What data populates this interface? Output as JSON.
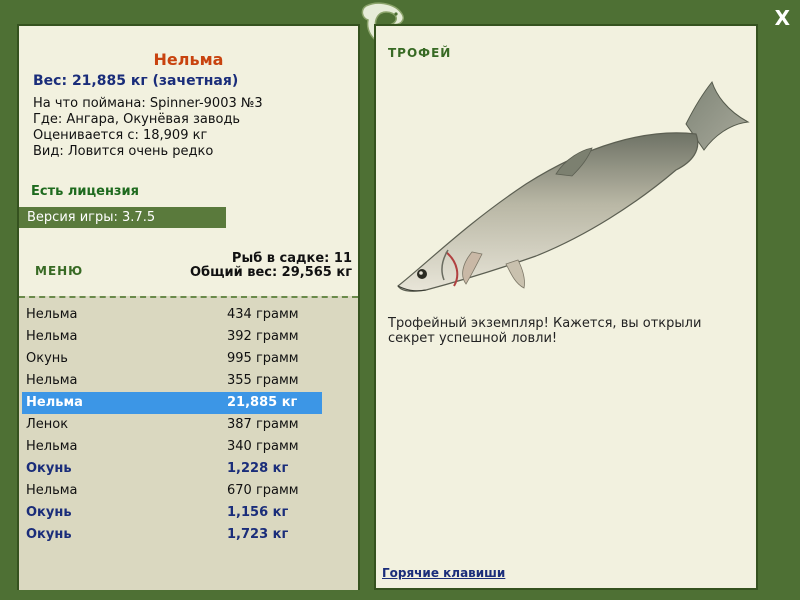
{
  "window": {
    "close_label": "X"
  },
  "left": {
    "fish_name": "Нельма",
    "weight": "Вес: 21,885 кг (зачетная)",
    "caught_with": "На что поймана: Spinner-9003 №3",
    "location": "Где: Ангара, Окунёвая заводь",
    "valued": "Оценивается с: 18,909 кг",
    "rarity": "Вид: Ловится очень редко",
    "license": "Есть лицензия",
    "version": "Версия игры: 3.7.5",
    "menu_label": "МЕНЮ",
    "fish_in_keepnet": "Рыб в садке: 11",
    "total_weight": "Общий вес: 29,565 кг"
  },
  "catch_list": [
    {
      "name": "Нельма",
      "weight": "434 грамм",
      "style": "normal"
    },
    {
      "name": "Нельма",
      "weight": "392 грамм",
      "style": "normal"
    },
    {
      "name": "Окунь",
      "weight": "995 грамм",
      "style": "normal"
    },
    {
      "name": "Нельма",
      "weight": "355 грамм",
      "style": "normal"
    },
    {
      "name": "Нельма",
      "weight": "21,885 кг",
      "style": "selected"
    },
    {
      "name": "Ленок",
      "weight": "387 грамм",
      "style": "normal"
    },
    {
      "name": "Нельма",
      "weight": "340 грамм",
      "style": "normal"
    },
    {
      "name": "Окунь",
      "weight": "1,228 кг",
      "style": "bold"
    },
    {
      "name": "Нельма",
      "weight": "670 грамм",
      "style": "normal"
    },
    {
      "name": "Окунь",
      "weight": "1,156 кг",
      "style": "bold"
    },
    {
      "name": "Окунь",
      "weight": "1,723 кг",
      "style": "bold"
    }
  ],
  "right": {
    "trophy_label": "ТРОФЕЙ",
    "description": "Трофейный экземпляр! Кажется, вы открыли секрет успешной ловли!",
    "hotkeys": "Горячие клавиши"
  },
  "icons": {
    "close": "close-icon",
    "logo": "fish-logo-icon",
    "fish_image": "nelma-fish-image"
  },
  "colors": {
    "frame": "#4e7034",
    "panel": "#f2f1df",
    "title": "#c8430f",
    "accent_blue": "#1a2d7a",
    "selection": "#3c96e6"
  }
}
